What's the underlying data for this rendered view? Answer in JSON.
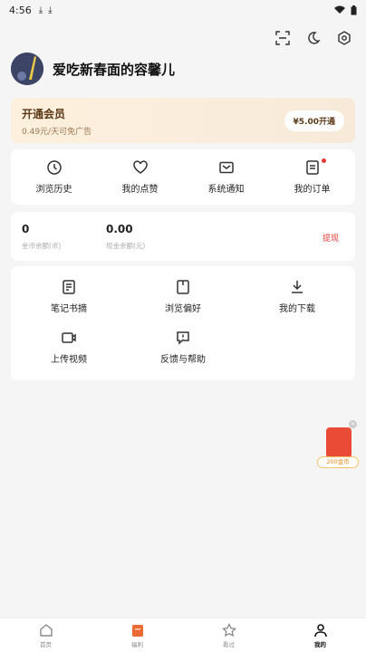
{
  "status": {
    "time": "4:56"
  },
  "profile": {
    "username": "爱吃新春面的容馨儿"
  },
  "vip": {
    "title": "开通会员",
    "subtitle": "0.49元/天可免广告",
    "button": "¥5.00开通"
  },
  "quick": [
    {
      "label": "浏览历史"
    },
    {
      "label": "我的点赞"
    },
    {
      "label": "系统通知"
    },
    {
      "label": "我的订单"
    }
  ],
  "wallet": {
    "coins": "0",
    "coins_label": "金币余额(币)",
    "cash": "0.00",
    "cash_label": "现金余额(元)",
    "withdraw": "提现"
  },
  "tools": [
    {
      "label": "笔记书摘"
    },
    {
      "label": "浏览偏好"
    },
    {
      "label": "我的下载"
    },
    {
      "label": "上传视频"
    },
    {
      "label": "反馈与帮助"
    }
  ],
  "redpack": {
    "tag": "200金币"
  },
  "tabs": [
    {
      "label": "首页"
    },
    {
      "label": "福利"
    },
    {
      "label": "看过"
    },
    {
      "label": "我的"
    }
  ],
  "colors": {
    "accent": "#e53935",
    "vip_bg": "#fdf0dd",
    "redpack": "#ea4b36"
  }
}
